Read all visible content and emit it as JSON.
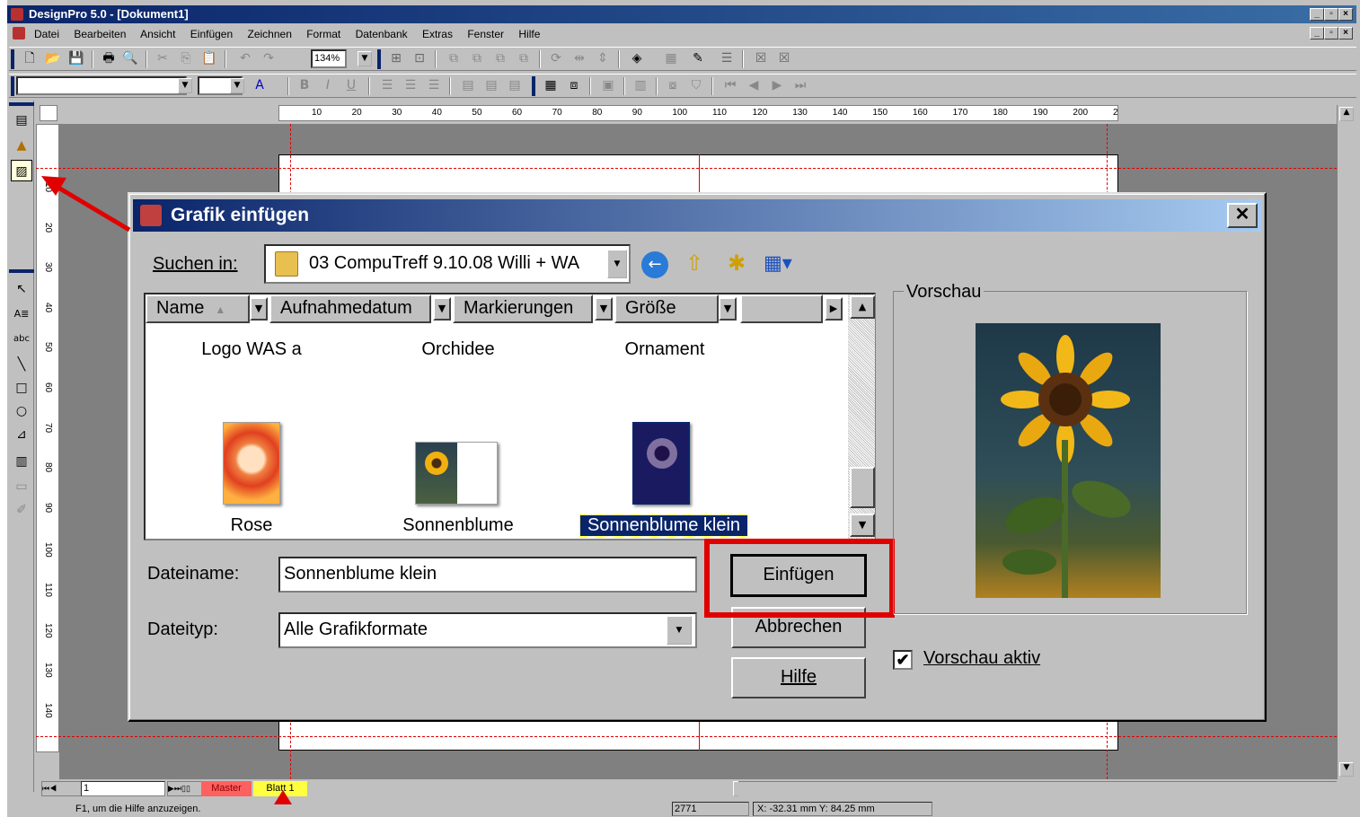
{
  "app": {
    "title": "DesignPro 5.0 - [Dokument1]",
    "caption_buttons": [
      "_",
      "▫",
      "×"
    ]
  },
  "menu": [
    "Datei",
    "Bearbeiten",
    "Ansicht",
    "Einfügen",
    "Zeichnen",
    "Format",
    "Datenbank",
    "Extras",
    "Fenster",
    "Hilfe"
  ],
  "toolbar": {
    "zoom": "134%"
  },
  "ruler": {
    "h_ticks": [
      "10",
      "20",
      "30",
      "40",
      "50",
      "60",
      "70",
      "80",
      "90",
      "100",
      "110",
      "120",
      "130",
      "140",
      "150",
      "160",
      "170",
      "180",
      "190",
      "200",
      "2"
    ],
    "v_ticks": [
      "10",
      "20",
      "30",
      "40",
      "50",
      "60",
      "70",
      "80",
      "90",
      "100",
      "110",
      "120",
      "130",
      "140"
    ]
  },
  "tabs": {
    "page_number": "1",
    "master": "Master",
    "sheet": "Blatt 1"
  },
  "status": {
    "help": "F1, um die Hilfe anzuzeigen.",
    "value": "2771",
    "coords": "X: -32.31 mm  Y: 84.25 mm"
  },
  "dialog": {
    "title": "Grafik einfügen",
    "look_in_label": "Suchen in:",
    "look_in_value": "03 CompuTreff 9.10.08 Willi + WA",
    "columns": [
      "Name",
      "Aufnahmedatum",
      "Markierungen",
      "Größe"
    ],
    "files": [
      {
        "name": "Logo WAS a"
      },
      {
        "name": "Orchidee"
      },
      {
        "name": "Ornament"
      },
      {
        "name": "Rose"
      },
      {
        "name": "Sonnenblume"
      },
      {
        "name": "Sonnenblume klein",
        "selected": true
      }
    ],
    "filename_label": "Dateiname:",
    "filename_value": "Sonnenblume klein",
    "filetype_label": "Dateityp:",
    "filetype_value": "Alle Grafikformate",
    "btn_insert": "Einfügen",
    "btn_cancel": "Abbrechen",
    "btn_help": "Hilfe",
    "preview_label": "Vorschau",
    "preview_checkbox": "Vorschau aktiv",
    "preview_checked": true
  },
  "colors": {
    "titlebar": "#0a246a",
    "annotation": "#e00000",
    "selection": "#0a246a"
  }
}
